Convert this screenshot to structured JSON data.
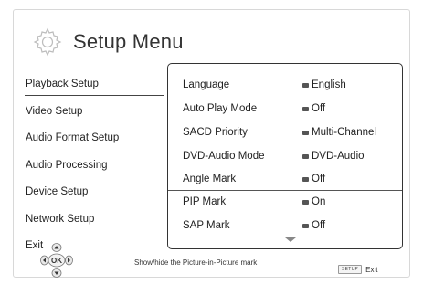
{
  "header": {
    "title": "Setup Menu",
    "icon": "gear-icon"
  },
  "menu": {
    "items": [
      {
        "label": "Playback Setup",
        "selected": true
      },
      {
        "label": "Video Setup"
      },
      {
        "label": "Audio Format Setup"
      },
      {
        "label": "Audio Processing"
      },
      {
        "label": "Device Setup"
      },
      {
        "label": "Network Setup"
      },
      {
        "label": "Exit"
      }
    ]
  },
  "settings": {
    "rows": [
      {
        "label": "Language",
        "value": "English"
      },
      {
        "label": "Auto Play Mode",
        "value": "Off"
      },
      {
        "label": "SACD Priority",
        "value": "Multi-Channel"
      },
      {
        "label": "DVD-Audio Mode",
        "value": "DVD-Audio"
      },
      {
        "label": "Angle Mark",
        "value": "Off"
      },
      {
        "label": "PIP Mark",
        "value": "On",
        "highlighted": true
      },
      {
        "label": "SAP Mark",
        "value": "Off"
      }
    ]
  },
  "footer": {
    "help_text": "Show/hide the Picture-in-Picture mark",
    "exit_key": "SETUP",
    "exit_label": "Exit",
    "dpad_center": "OK"
  }
}
